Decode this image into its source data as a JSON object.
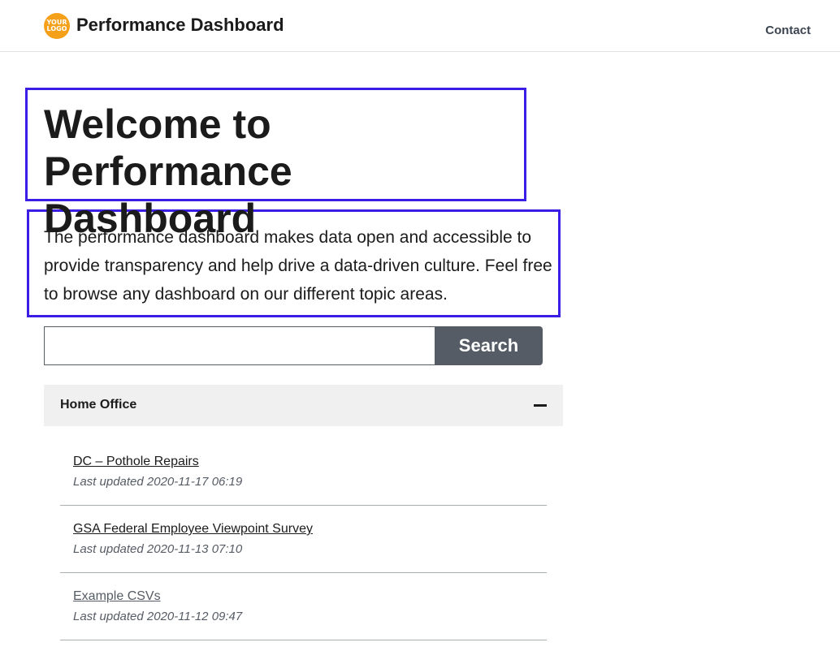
{
  "header": {
    "logo_line1": "YOUR",
    "logo_line2": "LOGO",
    "site_title": "Performance Dashboard",
    "contact_label": "Contact"
  },
  "main": {
    "heading": "Welcome to Performance Dashboard",
    "intro": "The performance dashboard makes data open and accessible to provide transparency and help drive a data-driven culture. Feel free to browse any dashboard on our different topic areas.",
    "search": {
      "value": "",
      "button_label": "Search"
    },
    "accordion": {
      "title": "Home Office",
      "items": [
        {
          "name": "DC – Pothole Repairs",
          "updated": "Last updated 2020-11-17 06:19"
        },
        {
          "name": "GSA Federal Employee Viewpoint Survey",
          "updated": "Last updated 2020-11-13 07:10"
        },
        {
          "name": "Example CSVs",
          "updated": "Last updated 2020-11-12 09:47"
        }
      ]
    }
  },
  "colors": {
    "logo": "#f5a01a",
    "highlight_border": "#3a1ee6",
    "search_button": "#565c65",
    "accordion_bg": "#f0f0f0"
  }
}
